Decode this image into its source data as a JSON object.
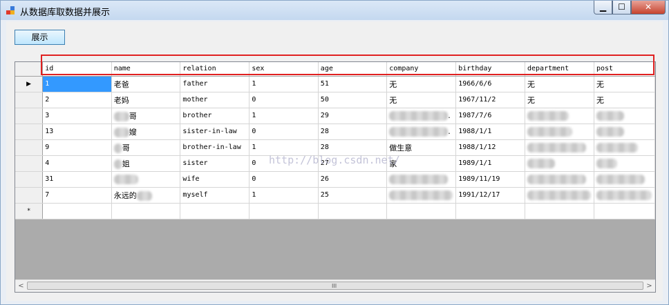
{
  "window": {
    "title": "从数据库取数据并展示",
    "minimize": "▁",
    "maximize": "☐",
    "close": "✕"
  },
  "toolbar": {
    "show_label": "展示"
  },
  "grid": {
    "columns": [
      "id",
      "name",
      "relation",
      "sex",
      "age",
      "company",
      "birthday",
      "department",
      "post"
    ],
    "rows": [
      {
        "id": "1",
        "name": "老爸",
        "relation": "father",
        "sex": "1",
        "age": "51",
        "company": "无",
        "birthday": "1966/6/6",
        "department": "无",
        "post": "无"
      },
      {
        "id": "2",
        "name": "老妈",
        "relation": "mother",
        "sex": "0",
        "age": "50",
        "company": "无",
        "birthday": "1967/11/2",
        "department": "无",
        "post": "无"
      },
      {
        "id": "3",
        "name": "哥",
        "relation": "brother",
        "sex": "1",
        "age": "29",
        "company": ".",
        "birthday": "1987/7/6",
        "department": "",
        "post": ""
      },
      {
        "id": "13",
        "name": "嫂",
        "relation": "sister-in-law",
        "sex": "0",
        "age": "28",
        "company": ".",
        "birthday": "1988/1/1",
        "department": "",
        "post": ""
      },
      {
        "id": "9",
        "name": "哥",
        "relation": "brother-in-law",
        "sex": "1",
        "age": "28",
        "company": "做生意",
        "birthday": "1988/1/12",
        "department": "",
        "post": ""
      },
      {
        "id": "4",
        "name": "姐",
        "relation": "sister",
        "sex": "0",
        "age": "27",
        "company": "家",
        "birthday": "1989/1/1",
        "department": "",
        "post": ""
      },
      {
        "id": "31",
        "name": "",
        "relation": "wife",
        "sex": "0",
        "age": "26",
        "company": "",
        "birthday": "1989/11/19",
        "department": "",
        "post": ""
      },
      {
        "id": "7",
        "name": "永远的",
        "relation": "myself",
        "sex": "1",
        "age": "25",
        "company": "",
        "birthday": "1991/12/17",
        "department": "",
        "post": ""
      }
    ],
    "current_row_marker": "▶",
    "new_row_marker": "*",
    "watermark": "http://blog.csdn.net/",
    "scroll_left": "<",
    "scroll_right": ">",
    "scroll_grip": "III"
  }
}
